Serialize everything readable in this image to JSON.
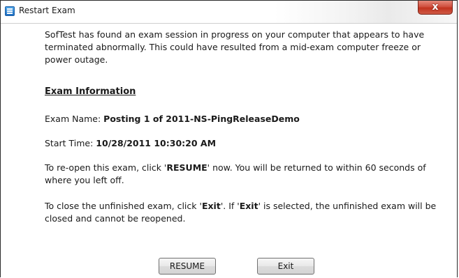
{
  "window": {
    "title": "Restart Exam",
    "close_label": "x"
  },
  "message": {
    "intro": "SofTest has found an exam session in progress on your computer that appears to have terminated abnormally. This could have resulted from a mid-exam computer freeze or power outage.",
    "heading": "Exam Information",
    "exam_name_label": "Exam Name: ",
    "exam_name_value": "Posting 1 of 2011-NS-PingReleaseDemo",
    "start_time_label": "Start Time: ",
    "start_time_value": "10/28/2011 10:30:20 AM",
    "resume_pre": "To re-open this exam, click '",
    "resume_keyword": "RESUME",
    "resume_post": "' now. You will be returned to within 60 seconds of where you left off.",
    "close_pre": "To close the unfinished exam, click '",
    "close_keyword_1": "Exit",
    "close_mid": "'. If '",
    "close_keyword_2": "Exit",
    "close_post": "' is selected, the unfinished exam will be closed and cannot be reopened."
  },
  "buttons": {
    "resume_label": "RESUME",
    "exit_label": "Exit"
  }
}
